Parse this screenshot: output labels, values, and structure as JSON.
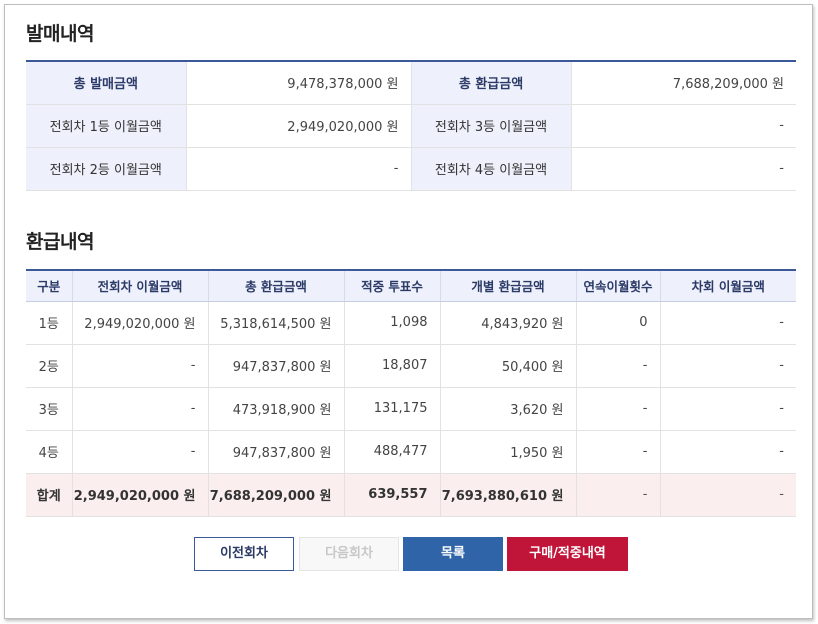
{
  "sales": {
    "title": "발매내역",
    "rows": [
      {
        "l1": "총 발매금액",
        "v1": "9,478,378,000 원",
        "l2": "총 환급금액",
        "v2": "7,688,209,000 원"
      },
      {
        "l1": "전회차 1등 이월금액",
        "v1": "2,949,020,000 원",
        "l2": "전회차 3등 이월금액",
        "v2": "-"
      },
      {
        "l1": "전회차 2등 이월금액",
        "v1": "-",
        "l2": "전회차 4등 이월금액",
        "v2": "-"
      }
    ]
  },
  "refund": {
    "title": "환급내역",
    "headers": [
      "구분",
      "전회차 이월금액",
      "총 환급금액",
      "적중 투표수",
      "개별 환급금액",
      "연속이월횟수",
      "차회 이월금액"
    ],
    "rows": [
      [
        "1등",
        "2,949,020,000 원",
        "5,318,614,500 원",
        "1,098",
        "4,843,920 원",
        "0",
        "-"
      ],
      [
        "2등",
        "-",
        "947,837,800 원",
        "18,807",
        "50,400 원",
        "-",
        "-"
      ],
      [
        "3등",
        "-",
        "473,918,900 원",
        "131,175",
        "3,620 원",
        "-",
        "-"
      ],
      [
        "4등",
        "-",
        "947,837,800 원",
        "488,477",
        "1,950 원",
        "-",
        "-"
      ],
      [
        "합계",
        "2,949,020,000 원",
        "7,688,209,000 원",
        "639,557",
        "7,693,880,610 원",
        "-",
        "-"
      ]
    ]
  },
  "buttons": {
    "prev": "이전회차",
    "next": "다음회차",
    "list": "목록",
    "buy": "구매/적중내역"
  },
  "colors": {
    "header_blue": "#3b5998",
    "label_bg": "#eef1fb",
    "total_bg": "#fbeeee",
    "list_btn": "#2f64a8",
    "buy_btn": "#c01438"
  }
}
